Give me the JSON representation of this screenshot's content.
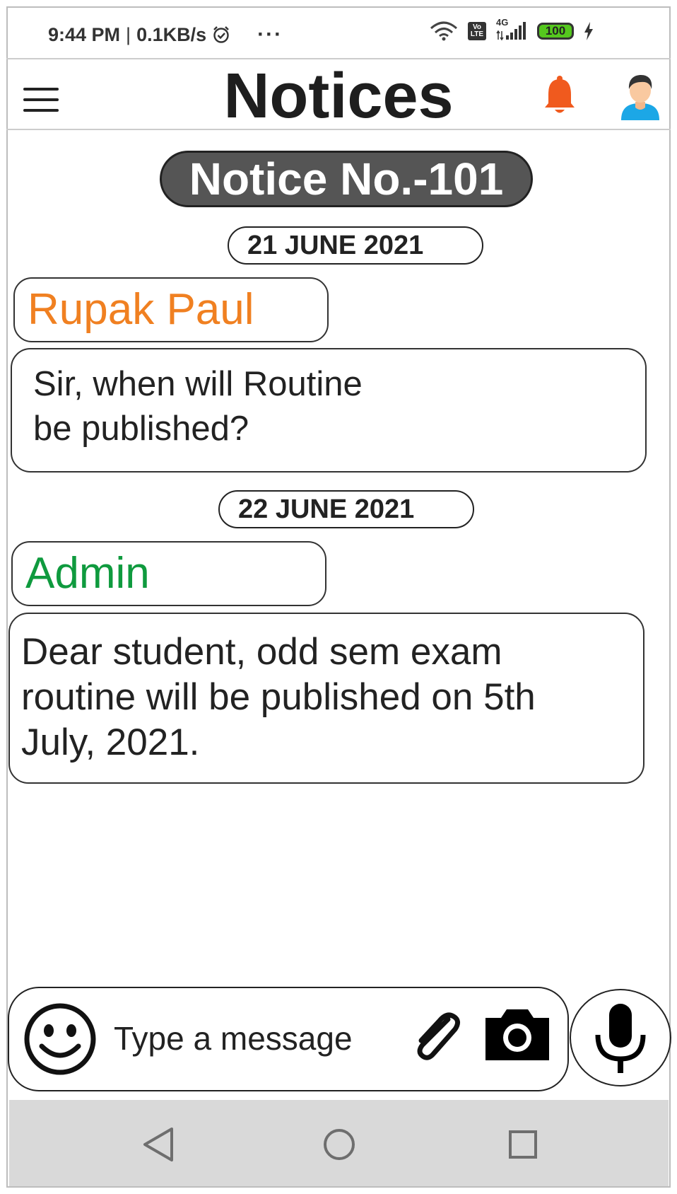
{
  "status_bar": {
    "time": "9:44 PM",
    "separator": "|",
    "speed": "0.1KB/s",
    "more": "···",
    "network": "4G",
    "volte_label": "Vo LTE",
    "battery": "100"
  },
  "header": {
    "title": "Notices"
  },
  "notice": {
    "label": "Notice No.-101"
  },
  "messages": [
    {
      "date": "21 JUNE 2021",
      "sender": "Rupak Paul",
      "sender_color": "#f08021",
      "lines": [
        "Sir, when will Routine",
        "be published?"
      ]
    },
    {
      "date": "22 JUNE 2021",
      "sender": "Admin",
      "sender_color": "#0f9a3e",
      "lines": [
        "Dear student, odd sem exam",
        "routine will be published on 5th",
        "July, 2021."
      ]
    }
  ],
  "input": {
    "placeholder": "Type a message"
  },
  "icons": {
    "menu": "hamburger-menu-icon",
    "notification": "bell-icon",
    "profile": "avatar-icon",
    "emoji": "smiley-icon",
    "attach": "paperclip-icon",
    "camera": "camera-icon",
    "mic": "microphone-icon",
    "back": "back-triangle-icon",
    "home": "home-circle-icon",
    "recent": "recent-square-icon"
  },
  "colors": {
    "bell": "#f05a1e",
    "pill_bg": "#555555",
    "nav_bg": "#d9d9d9"
  }
}
